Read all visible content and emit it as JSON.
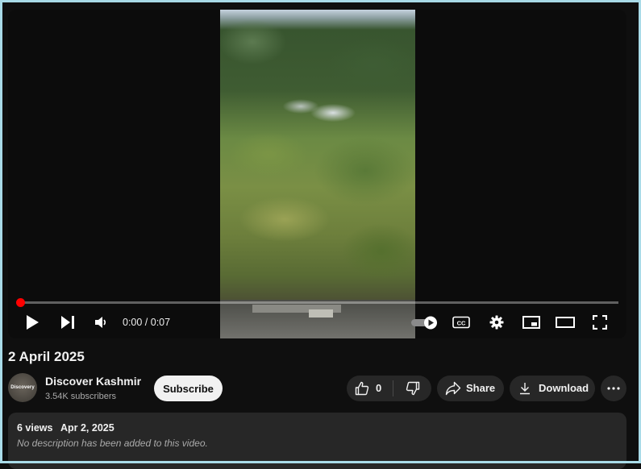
{
  "player": {
    "time_display": "0:00 / 0:07",
    "progress_fraction": 0.0,
    "accent_color": "#ff0000",
    "controls": {
      "play": "play-icon",
      "next": "next-icon",
      "volume": "volume-icon",
      "autoplay": "autoplay-toggle-icon",
      "captions_label": "CC",
      "settings": "gear-icon",
      "miniplayer": "miniplayer-icon",
      "theater": "theater-mode-icon",
      "fullscreen": "fullscreen-icon"
    }
  },
  "video": {
    "title": "2 April 2025"
  },
  "channel": {
    "name": "Discover Kashmir",
    "subscribers": "3.54K subscribers",
    "avatar_text": "Discovery",
    "subscribe_label": "Subscribe"
  },
  "actions": {
    "like_count": "0",
    "share_label": "Share",
    "download_label": "Download"
  },
  "description": {
    "views": "6 views",
    "date": "Apr 2, 2025",
    "text": "No description has been added to this video."
  }
}
